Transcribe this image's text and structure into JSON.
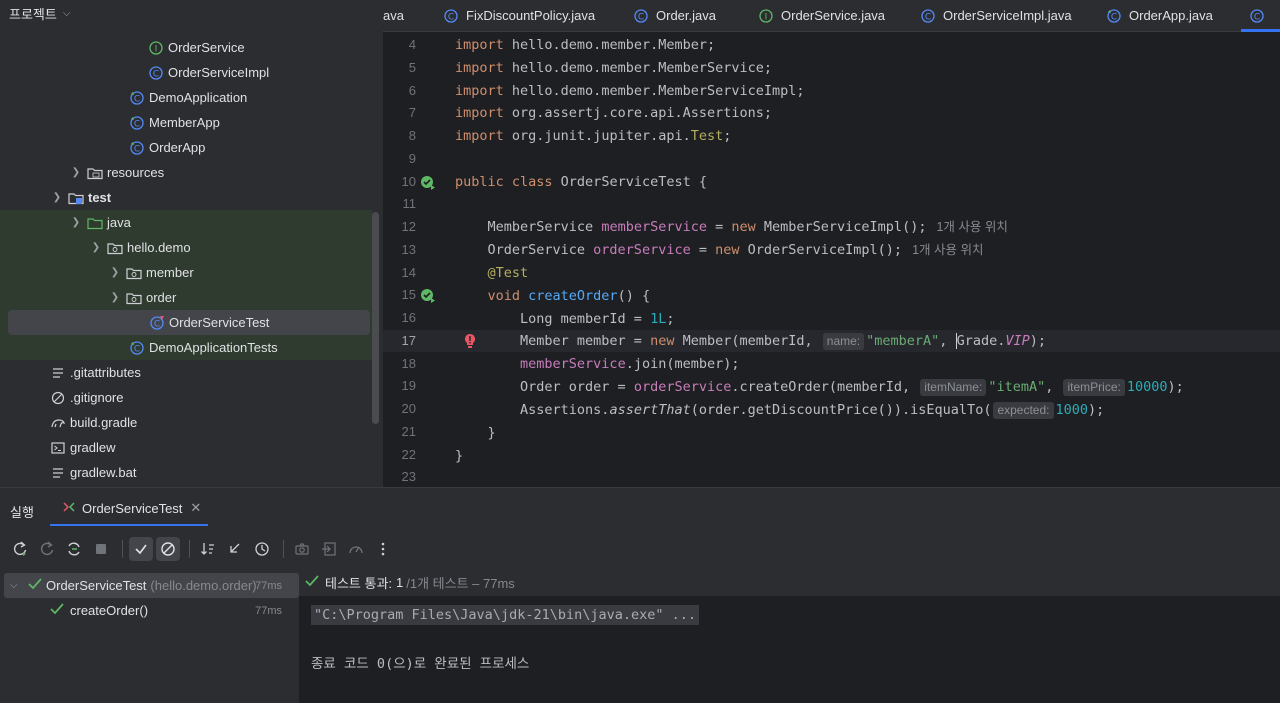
{
  "project": {
    "header": "프로젝트",
    "items": [
      {
        "label": "OrderService",
        "icon": "interface-icon"
      },
      {
        "label": "OrderServiceImpl",
        "icon": "class-icon"
      },
      {
        "label": "DemoApplication",
        "icon": "spring-class-icon"
      },
      {
        "label": "MemberApp",
        "icon": "spring-class-icon"
      },
      {
        "label": "OrderApp",
        "icon": "spring-class-icon"
      },
      {
        "label": "resources",
        "icon": "folder-icon"
      },
      {
        "label": "test",
        "icon": "test-folder-icon"
      },
      {
        "label": "java",
        "icon": "folder-icon"
      },
      {
        "label": "hello.demo",
        "icon": "package-icon"
      },
      {
        "label": "member",
        "icon": "package-icon"
      },
      {
        "label": "order",
        "icon": "package-icon"
      },
      {
        "label": "OrderServiceTest",
        "icon": "test-class-icon"
      },
      {
        "label": "DemoApplicationTests",
        "icon": "spring-class-icon"
      },
      {
        "label": ".gitattributes",
        "icon": "text-file-icon"
      },
      {
        "label": ".gitignore",
        "icon": "ignore-file-icon"
      },
      {
        "label": "build.gradle",
        "icon": "gradle-icon"
      },
      {
        "label": "gradlew",
        "icon": "terminal-icon"
      },
      {
        "label": "gradlew.bat",
        "icon": "text-file-icon"
      }
    ]
  },
  "tabs": [
    {
      "label": "ava"
    },
    {
      "label": "FixDiscountPolicy.java"
    },
    {
      "label": "Order.java"
    },
    {
      "label": "OrderService.java"
    },
    {
      "label": "OrderServiceImpl.java"
    },
    {
      "label": "OrderApp.java"
    }
  ],
  "editor": {
    "line_numbers": [
      "4",
      "5",
      "6",
      "7",
      "8",
      "9",
      "10",
      "11",
      "12",
      "13",
      "14",
      "15",
      "16",
      "17",
      "18",
      "19",
      "20",
      "21",
      "22",
      "23"
    ],
    "current_line": "17",
    "usage_hint": "1개 사용 위치",
    "hints": {
      "name": "name:",
      "itemName": "itemName:",
      "itemPrice": "itemPrice:",
      "expected": "expected:"
    }
  },
  "run": {
    "title": "실행",
    "tab_label": "OrderServiceTest",
    "tree": {
      "root_label": "OrderServiceTest",
      "root_pkg": "(hello.demo.order)",
      "root_duration": "77ms",
      "child_label": "createOrder()",
      "child_duration": "77ms"
    },
    "status_prefix": "테스트 통과:",
    "status_count": "1",
    "status_suffix": "/1개 테스트 – 77ms",
    "console_cmd": "\"C:\\Program Files\\Java\\jdk-21\\bin\\java.exe\" ...",
    "console_exit": "종료 코드 0(으)로 완료된 프로세스"
  },
  "colors": {
    "accent": "#3574f0",
    "success": "#5fb865",
    "error": "#e55765"
  }
}
